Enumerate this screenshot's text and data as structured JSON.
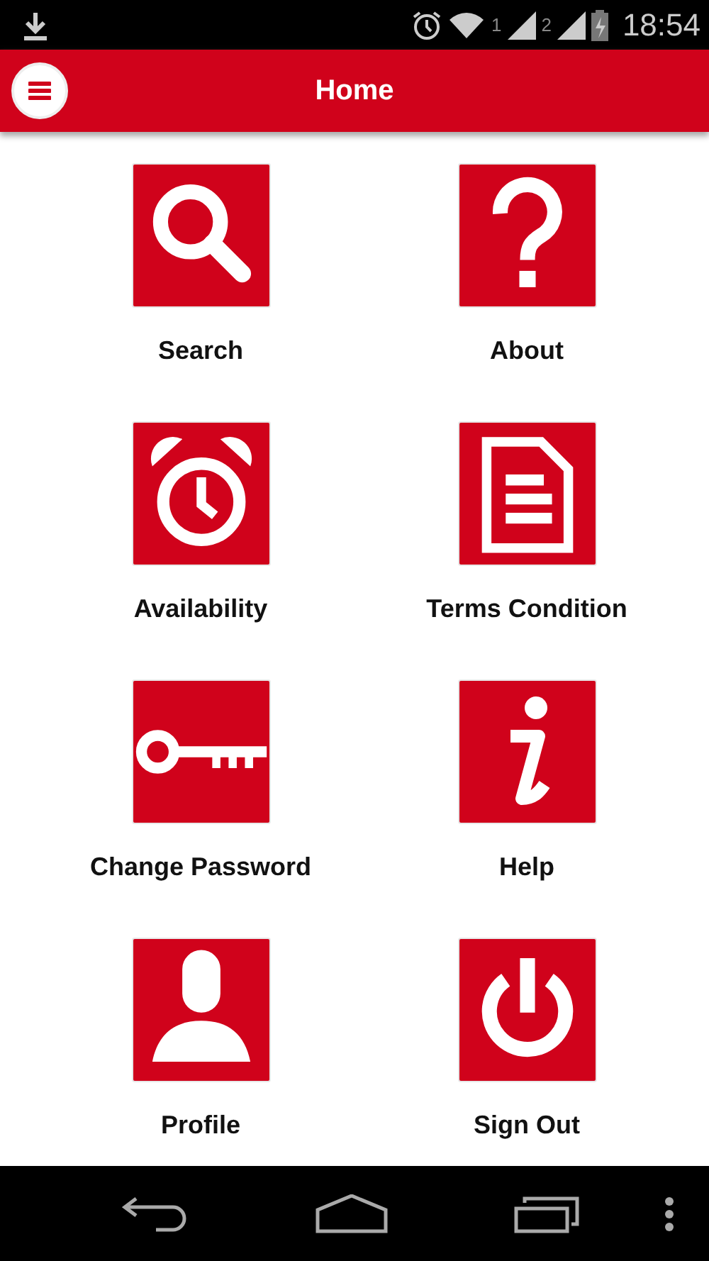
{
  "status_bar": {
    "sim_1": "1",
    "sim_2": "2",
    "time": "18:54"
  },
  "header": {
    "title": "Home"
  },
  "tiles": [
    {
      "label": "Search",
      "kind": "search"
    },
    {
      "label": "About",
      "kind": "about"
    },
    {
      "label": "Availability",
      "kind": "alarm"
    },
    {
      "label": "Terms Condition",
      "kind": "document"
    },
    {
      "label": "Change Password",
      "kind": "key"
    },
    {
      "label": "Help",
      "kind": "info"
    },
    {
      "label": "Profile",
      "kind": "person"
    },
    {
      "label": "Sign Out",
      "kind": "power"
    }
  ]
}
